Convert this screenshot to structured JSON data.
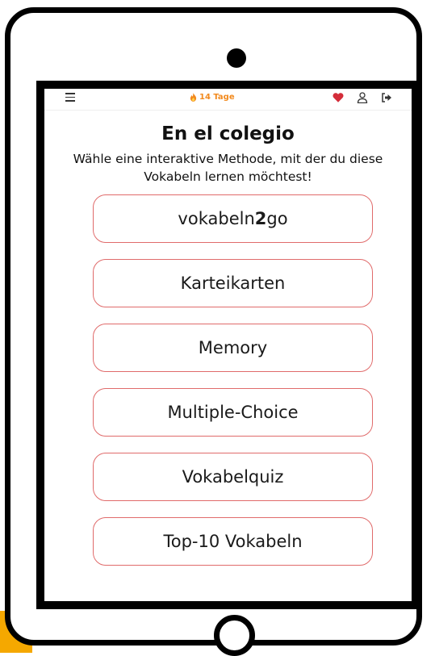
{
  "topbar": {
    "streak_label": "14 Tage",
    "icons": [
      "menu-icon",
      "flame-icon",
      "heart-icon",
      "user-icon",
      "logout-icon"
    ]
  },
  "page": {
    "title": "En el colegio",
    "subtitle": "Wähle eine interaktive Methode, mit der du diese Vokabeln lernen möchtest!"
  },
  "methods": [
    {
      "label_prefix": "vokabeln",
      "label_bold": "2",
      "label_suffix": "go"
    },
    {
      "label": "Karteikarten"
    },
    {
      "label": "Memory"
    },
    {
      "label": "Multiple-Choice"
    },
    {
      "label": "Vokabelquiz"
    },
    {
      "label": "Top-10 Vokabeln"
    }
  ],
  "colors": {
    "button_border": "#e06b6b",
    "streak": "#f28a1e",
    "heart": "#d42d3a",
    "accent_corner": "#f5a800"
  }
}
